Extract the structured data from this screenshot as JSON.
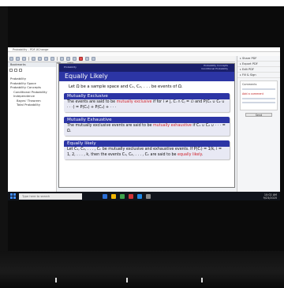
{
  "app": {
    "window_title": "Probability - PDF-XChange",
    "menu": [
      "File",
      "Edit",
      "View",
      "Comments",
      "Help"
    ]
  },
  "nav": {
    "header": "Bookmarks",
    "items": [
      {
        "label": "Probability",
        "level": 1
      },
      {
        "label": "Probability Space",
        "level": 1
      },
      {
        "label": "Probability Concepts",
        "level": 1
      },
      {
        "label": "Conditional Probability",
        "level": 2
      },
      {
        "label": "Independence",
        "level": 2
      },
      {
        "label": "Bayes' Theorem",
        "level": 3
      },
      {
        "label": "Total Probability",
        "level": 3
      }
    ]
  },
  "slide": {
    "header_left": "Probability",
    "header_right_1": "Probability Concepts",
    "header_right_2": "Conditional Probability",
    "title": "Equally Likely",
    "intro": "Let Ω be a sample space and C₁, C₂, . . . be events of Ω.",
    "blocks": [
      {
        "title": "Mutually Exclusive",
        "text_before": "The events are said to be ",
        "highlight": "mutually exclusive",
        "text_after": " if for i ≠ j, Cᵢ ∩ Cⱼ = ∅ and P(C₁ ∪ C₂ ∪ · · ·) = P(C₁) + P(C₂) + · · ·"
      },
      {
        "title": "Mutually Exhaustive",
        "text_before": "The mutually exclusive events are said to be ",
        "highlight": "mutually exhaustive",
        "text_after": " if C₁ ∪ C₂ ∪ · · · = Ω."
      },
      {
        "title": "Equally likely",
        "text_before": "Let C₁, C₂, . . . , Cₖ be mutually exclusive and exhaustive events. If P(Cᵢ) = 1/k, i = 1, 2, . . . , k, then the events C₁, C₂, . . . , Cₖ are said to be ",
        "highlight": "equally likely",
        "text_after": "."
      }
    ]
  },
  "right_pane": {
    "items": [
      "Share PDF",
      "Export PDF",
      "Edit PDF",
      "Fill & Sign"
    ],
    "box_heading": "Comments",
    "box_note": "Add a comment",
    "button": "Send"
  },
  "taskbar": {
    "search_placeholder": "Type here to search",
    "time": "10:02 AM",
    "date": "9/23/2020",
    "task_colors": [
      "#2a6fd6",
      "#f2b705",
      "#3fa34d",
      "#d13438",
      "#1f88e5",
      "#888888"
    ]
  },
  "colors": {
    "slide_title_bg": "#2c35a5",
    "highlight": "#d0202a"
  }
}
